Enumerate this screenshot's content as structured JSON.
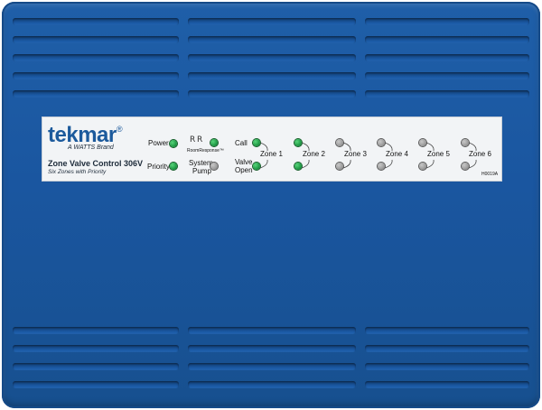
{
  "brand": {
    "name": "tekmar",
    "registered": "®",
    "tagline": "A WATTS Brand"
  },
  "product": {
    "title": "Zone Valve Control 306V",
    "subtitle": "Six Zones with Priority",
    "code": "H0019A"
  },
  "indicators": {
    "power_label": "Power",
    "priority_label": "Priority",
    "roomresponse_label": "RoomResponse™",
    "system_pump_label_line1": "System",
    "system_pump_label_line2": "Pump",
    "call_label": "Call",
    "valve_open_line1": "Valve",
    "valve_open_line2": "Open"
  },
  "zones": [
    {
      "label": "Zone 1",
      "call_on": true,
      "valve_on": true
    },
    {
      "label": "Zone 2",
      "call_on": true,
      "valve_on": true
    },
    {
      "label": "Zone 3",
      "call_on": false,
      "valve_on": false
    },
    {
      "label": "Zone 4",
      "call_on": false,
      "valve_on": false
    },
    {
      "label": "Zone 5",
      "call_on": false,
      "valve_on": false
    },
    {
      "label": "Zone 6",
      "call_on": false,
      "valve_on": false
    }
  ],
  "colors": {
    "housing": "#1a56a0",
    "led_on": "#1f9a45",
    "led_off": "#9c9c9c",
    "brand": "#1c5a9c"
  }
}
